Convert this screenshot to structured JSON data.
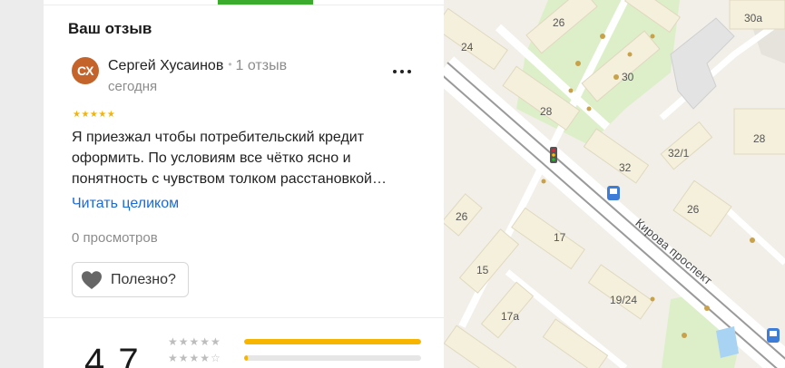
{
  "review": {
    "section_title": "Ваш отзыв",
    "author": {
      "initials": "СХ",
      "name": "Сергей Хусаинов",
      "review_count": "1 отзыв",
      "date": "сегодня",
      "avatar_color": "#c4642a"
    },
    "rating_stars": "★★★★★",
    "rating": 5,
    "text_lines": [
      "Я приезжал чтобы потребительский кредит",
      "оформить. По условиям все чётко ясно и",
      "понятность с чувством толком расстановкой…"
    ],
    "read_more_label": "Читать целиком",
    "views": "0 просмотров",
    "helpful_label": "Полезно?",
    "menu_icon": "more-dots-icon"
  },
  "summary": {
    "average_rating": "4,7",
    "distribution": [
      {
        "stars": "★★★★★",
        "fraction": 1.0
      },
      {
        "stars": "★★★★☆",
        "fraction": 0.02
      }
    ]
  },
  "map": {
    "street": "Кирова проспект",
    "house_numbers": [
      "24",
      "26",
      "30a",
      "30",
      "28",
      "32/1",
      "28",
      "32",
      "26",
      "26",
      "17",
      "15",
      "19/24",
      "17a"
    ],
    "icons": [
      "traffic-light-icon",
      "bus-stop-icon"
    ],
    "colors": {
      "background": "#f2efe9",
      "building": "#f5f0dc",
      "park": "#dcefc9",
      "road": "#ffffff",
      "tram_track": "#8f8f8f"
    }
  }
}
